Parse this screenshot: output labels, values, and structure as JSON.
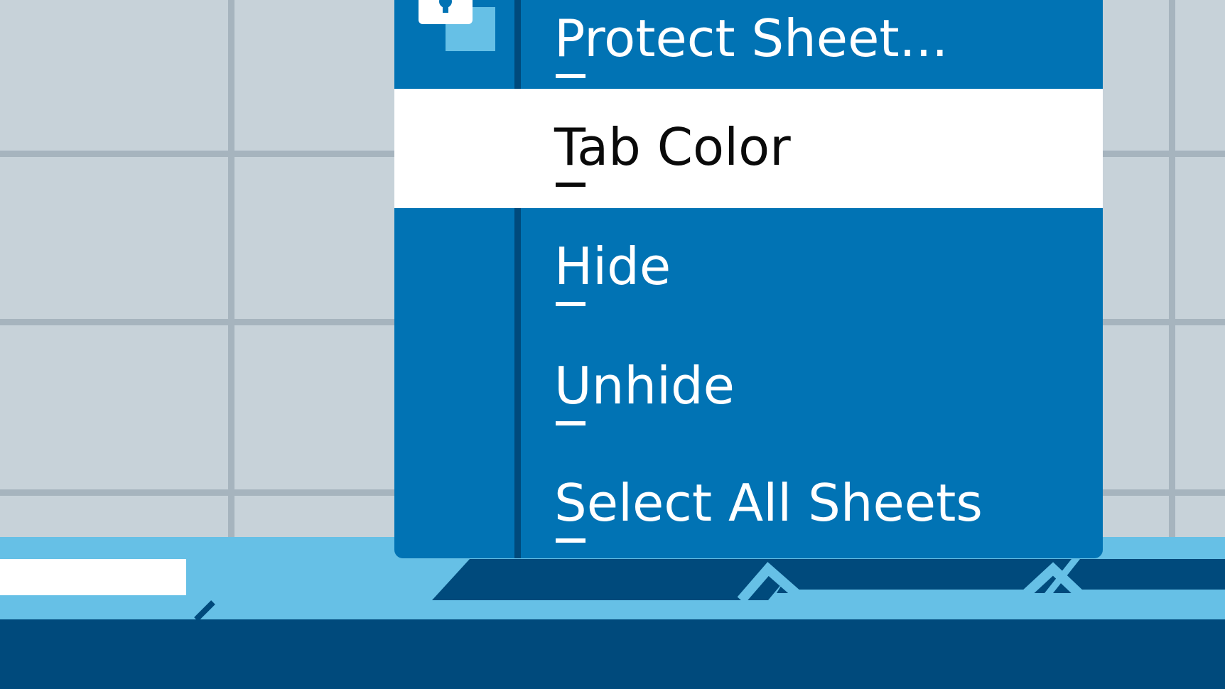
{
  "context_menu": {
    "items": [
      {
        "label": "Protect Sheet...",
        "mnemonic": "P",
        "icon": "lock-icon"
      },
      {
        "label": "Tab Color",
        "mnemonic": "T",
        "state": "highlighted"
      },
      {
        "label": "Hide",
        "mnemonic": "H"
      },
      {
        "label": "Unhide",
        "mnemonic": "U"
      },
      {
        "label": "Select All Sheets",
        "mnemonic": "S"
      }
    ]
  },
  "colors": {
    "grid_background": "#c7d2d9",
    "grid_lines": "#a6b4be",
    "menu_background": "#0173b4",
    "menu_highlight": "#ffffff",
    "tab_bar_light": "#66c0e6",
    "tab_bar_dark": "#004a7c",
    "icon_accent": "#66c0e6"
  }
}
